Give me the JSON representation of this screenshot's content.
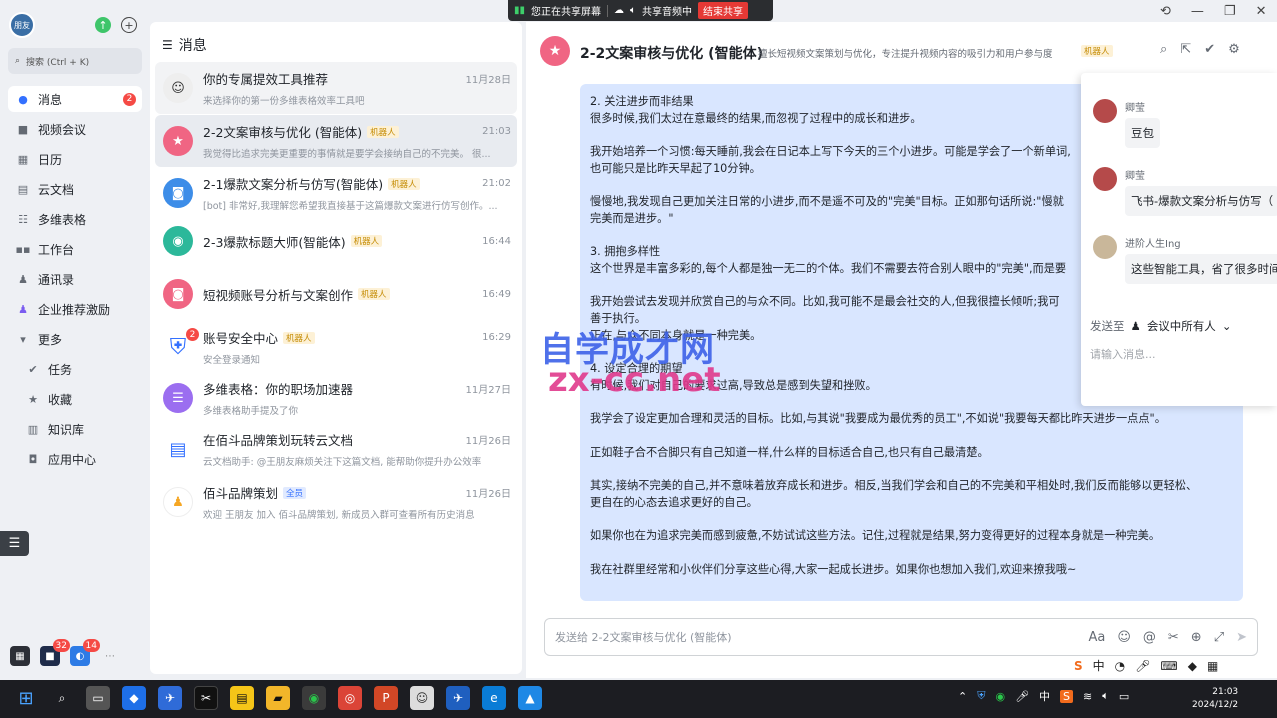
{
  "share": {
    "status": "您正在共享屏幕",
    "audio": "共享音频中",
    "end": "结束共享"
  },
  "nav": {
    "avatar": "朋友",
    "search": "搜索 (Ctrl + K)",
    "items": [
      {
        "label": "消息",
        "badge": "2"
      },
      {
        "label": "视频会议"
      },
      {
        "label": "日历"
      },
      {
        "label": "云文档"
      },
      {
        "label": "多维表格"
      },
      {
        "label": "工作台"
      },
      {
        "label": "通讯录"
      },
      {
        "label": "企业推荐激励"
      },
      {
        "label": "更多"
      },
      {
        "label": "任务"
      },
      {
        "label": "收藏"
      },
      {
        "label": "知识库"
      },
      {
        "label": "应用中心"
      }
    ],
    "bottom_badges": [
      "32",
      "14"
    ]
  },
  "list": {
    "title": "消息",
    "items": [
      {
        "name": "你的专属提效工具推荐",
        "tag": "",
        "time": "11月28日",
        "preview": "来选择你的第一份多维表格效率工具吧"
      },
      {
        "name": "2-2文案审核与优化 (智能体)",
        "tag": "机器人",
        "time": "21:03",
        "preview": "我觉得比追求完美更重要的事情就是要学会接纳自己的不完美。 很..."
      },
      {
        "name": "2-1爆款文案分析与仿写(智能体)",
        "tag": "机器人",
        "time": "21:02",
        "preview": "[bot] 非常好,我理解您希望我直接基于这篇爆款文案进行仿写创作。..."
      },
      {
        "name": "2-3爆款标题大师(智能体)",
        "tag": "机器人",
        "time": "16:44",
        "preview": ""
      },
      {
        "name": "短视频账号分析与文案创作",
        "tag": "机器人",
        "time": "16:49",
        "preview": ""
      },
      {
        "name": "账号安全中心",
        "tag": "机器人",
        "time": "16:29",
        "preview": "安全登录通知",
        "badge": "2"
      },
      {
        "name": "多维表格：你的职场加速器",
        "tag": "",
        "time": "11月27日",
        "preview": "多维表格助手提及了你"
      },
      {
        "name": "在佰斗品牌策划玩转云文档",
        "tag": "",
        "time": "11月26日",
        "preview": "云文档助手: @王朋友麻烦关注下这篇文档, 能帮助你提升办公效率"
      },
      {
        "name": "佰斗品牌策划",
        "tag": "全员",
        "time": "11月26日",
        "preview": "欢迎 王朋友 加入 佰斗品牌策划, 新成员入群可查看所有历史消息"
      }
    ]
  },
  "chat": {
    "title": "2-2文案审核与优化 (智能体)",
    "desc": "擅长短视频文案策划与优化，专注提升视频内容的吸引力和用户参与度",
    "tag": "机器人",
    "lines": [
      "2. 关注进步而非结果",
      "很多时候,我们太过在意最终的结果,而忽视了过程中的成长和进步。",
      "",
      "我开始培养一个习惯:每天睡前,我会在日记本上写下今天的三个小进步。可能是学会了一个新单词,",
      "也可能只是比昨天早起了10分钟。",
      "",
      "慢慢地,我发现自己更加关注日常的小进步,而不是遥不可及的\"完美\"目标。正如那句话所说:\"慢就",
      "完美而是进步。\"",
      "",
      "3. 拥抱多样性",
      "这个世界是丰富多彩的,每个人都是独一无二的个体。我们不需要去符合别人眼中的\"完美\",而是要",
      "",
      "我开始尝试去发现并欣赏自己的与众不同。比如,我可能不是最会社交的人,但我很擅长倾听;我可",
      "善于执行。",
      "正在,与众不同本身就是一种完美。",
      "",
      "4. 设定合理的期望",
      "有时候,我们对自己的要求过高,导致总是感到失望和挫败。",
      "",
      "我学会了设定更加合理和灵活的目标。比如,与其说\"我要成为最优秀的员工\",不如说\"我要每天都比昨天进步一点点\"。",
      "",
      "正如鞋子合不合脚只有自己知道一样,什么样的目标适合自己,也只有自己最清楚。",
      "",
      "其实,接纳不完美的自己,并不意味着放弃成长和进步。相反,当我们学会和自己的不完美和平相处时,我们反而能够以更轻松、",
      "更自在的心态去追求更好的自己。",
      "",
      "如果你也在为追求完美而感到疲惫,不妨试试这些方法。记住,过程就是结果,努力变得更好的过程本身就是一种完美。",
      "",
      "我在社群里经常和小伙伴们分享这些心得,大家一起成长进步。如果你也想加入我们,欢迎来撩我哦~"
    ],
    "input_placeholder": "发送给 2-2文案审核与优化 (智能体)"
  },
  "watermark": {
    "line1": "自学成才网",
    "line2": "zx-cc.net"
  },
  "panel": {
    "messages": [
      {
        "name": "卿莹",
        "text": "豆包"
      },
      {
        "name": "卿莹",
        "text": "飞书-爆款文案分析与仿写（"
      },
      {
        "name": "进阶人生Ing",
        "text": "这些智能工具，省了很多时间"
      }
    ],
    "sendto_label": "发送至",
    "sendto_value": "会议中所有人",
    "input_placeholder": "请输入消息..."
  },
  "taskbar": {
    "ime": "中",
    "time": "21:03",
    "date": "2024/12/2"
  },
  "colors": {
    "accent": "#3370ff",
    "bubble": "#d9e6ff",
    "badge": "#f54a45",
    "bot_tag_bg": "#fdf1d6"
  }
}
